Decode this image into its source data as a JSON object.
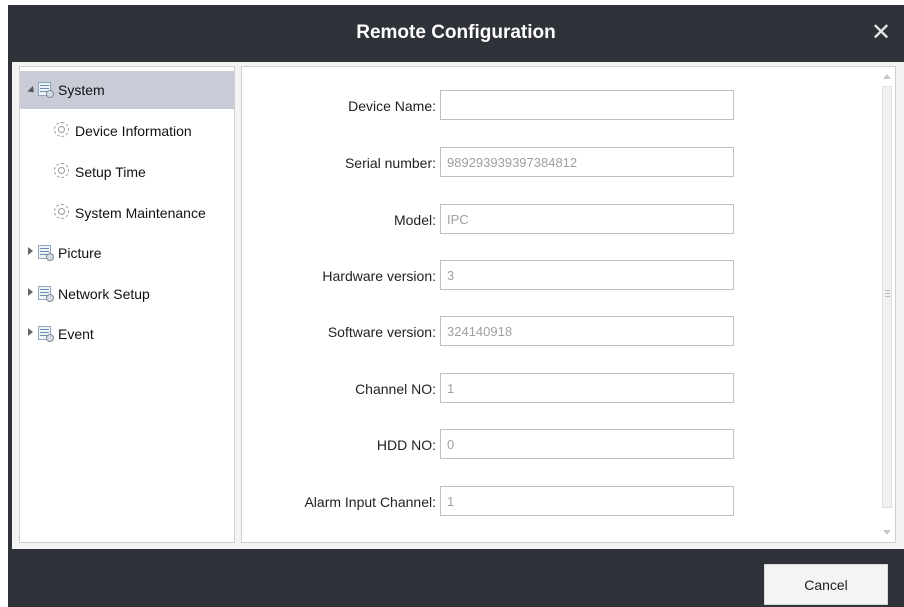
{
  "window": {
    "title": "Remote Configuration",
    "close_symbol": "✕"
  },
  "tree": {
    "items": [
      {
        "label": "System",
        "icon": "folder-settings-icon",
        "expanded": true,
        "selected": true
      },
      {
        "label": "Device Information",
        "icon": "gear-icon",
        "child": true
      },
      {
        "label": "Setup Time",
        "icon": "gear-icon",
        "child": true
      },
      {
        "label": "System Maintenance",
        "icon": "gear-icon",
        "child": true
      },
      {
        "label": "Picture",
        "icon": "folder-settings-icon",
        "expanded": false
      },
      {
        "label": "Network Setup",
        "icon": "folder-settings-icon",
        "expanded": false
      },
      {
        "label": "Event",
        "icon": "folder-settings-icon",
        "expanded": false
      }
    ]
  },
  "form": {
    "fields": [
      {
        "label": "Device Name:",
        "value": "",
        "editable": true
      },
      {
        "label": "Serial number:",
        "value": "989293939397384812",
        "editable": false
      },
      {
        "label": "Model:",
        "value": "IPC",
        "editable": false
      },
      {
        "label": "Hardware version:",
        "value": "3",
        "editable": false
      },
      {
        "label": "Software version:",
        "value": "324140918",
        "editable": false
      },
      {
        "label": "Channel NO:",
        "value": "1",
        "editable": false
      },
      {
        "label": "HDD NO:",
        "value": "0",
        "editable": false
      },
      {
        "label": "Alarm Input Channel:",
        "value": "1",
        "editable": false
      }
    ]
  },
  "footer": {
    "cancel_label": "Cancel"
  },
  "colors": {
    "frame": "#2f3238",
    "selection": "#c9ccd6"
  }
}
